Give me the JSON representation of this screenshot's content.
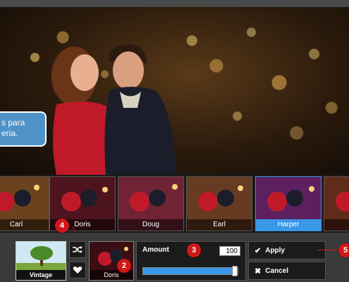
{
  "tooltip": {
    "line1": "s para",
    "line2": "eria."
  },
  "filters": [
    {
      "label": "Carl",
      "tint": "#b8783a"
    },
    {
      "label": "Doris",
      "tint": "#7a2030"
    },
    {
      "label": "Doug",
      "tint": "#c0405a"
    },
    {
      "label": "Earl",
      "tint": "#b06a40"
    },
    {
      "label": "Harper",
      "tint": "#9a3aa0",
      "selected": true
    },
    {
      "label": "",
      "tint": "#a05030"
    }
  ],
  "preset": {
    "label": "Vintage"
  },
  "current_filter": {
    "label": "Doris"
  },
  "amount": {
    "label": "Amount",
    "value": "100",
    "level_percent": 100
  },
  "actions": {
    "apply_label": "Apply",
    "cancel_label": "Cancel"
  },
  "badges": {
    "b2": "2",
    "b3": "3",
    "b4": "4",
    "b5": "5"
  },
  "colors": {
    "accent": "#3a98e8",
    "badge": "#d01818",
    "tooltip": "#4e92c8"
  }
}
